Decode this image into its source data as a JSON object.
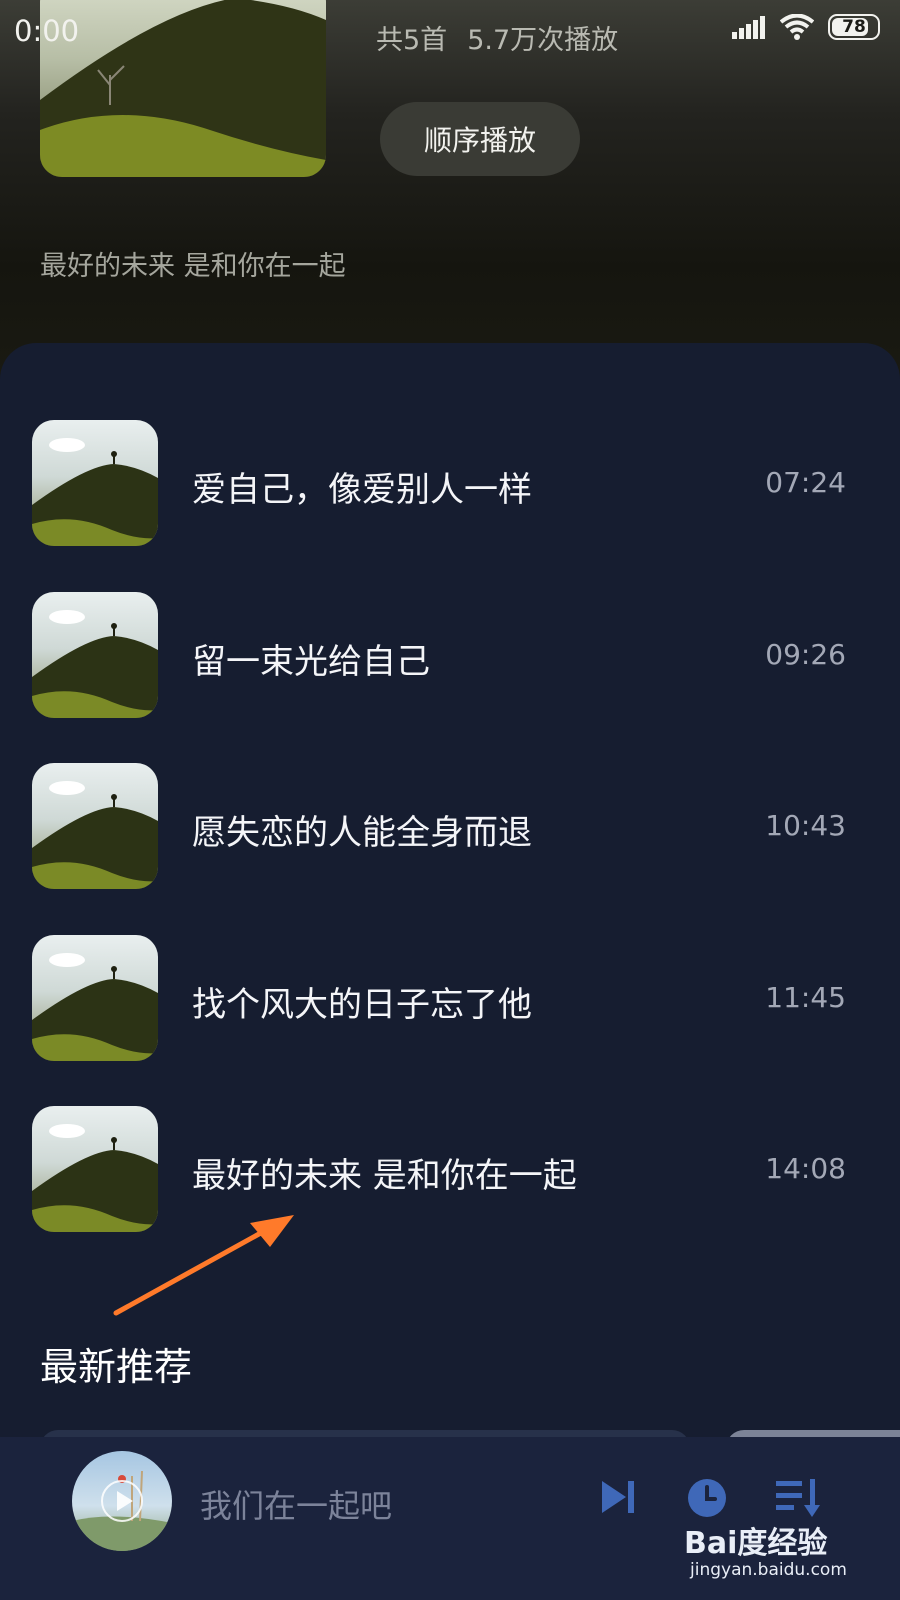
{
  "status_bar": {
    "time": "0:00",
    "battery": "78"
  },
  "header": {
    "stats_count": "共5首",
    "stats_plays": "5.7万次播放",
    "play_order_label": "顺序播放",
    "current_track_desc": "最好的未来 是和你在一起"
  },
  "tracks": [
    {
      "title": "爱自己，像爱别人一样",
      "duration": "07:24"
    },
    {
      "title": "留一束光给自己",
      "duration": "09:26"
    },
    {
      "title": "愿失恋的人能全身而退",
      "duration": "10:43"
    },
    {
      "title": "找个风大的日子忘了他",
      "duration": "11:45"
    },
    {
      "title": "最好的未来 是和你在一起",
      "duration": "14:08"
    }
  ],
  "annotation": {
    "label": "最新推荐",
    "color": "#ff7a2a"
  },
  "player": {
    "now_playing": "我们在一起吧"
  },
  "watermark": {
    "logo": "Bai度经验",
    "url": "jingyan.baidu.com"
  },
  "icons": [
    "signal-icon",
    "wifi-icon",
    "battery-icon",
    "next-track-icon",
    "timer-icon",
    "playlist-icon",
    "play-icon"
  ],
  "colors": {
    "panel_bg": "#161d30",
    "player_bg": "#1b233d",
    "accent_annotation": "#ff7a2a"
  }
}
